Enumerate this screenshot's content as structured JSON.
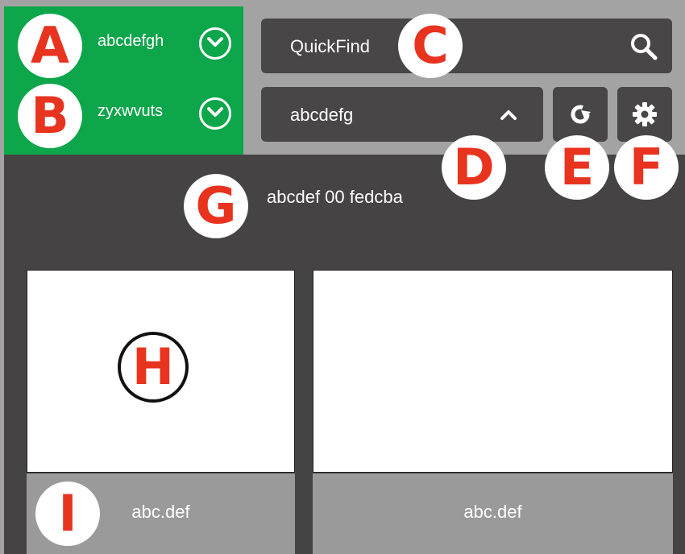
{
  "filters": {
    "filter_a": {
      "label": "abcdefgh",
      "icon": "chevron-down-circle-icon"
    },
    "filter_b": {
      "label": "zyxwvuts",
      "icon": "chevron-down-circle-icon"
    }
  },
  "search": {
    "text": "QuickFind",
    "icon": "search-icon"
  },
  "dropdown": {
    "value": "abcdefg",
    "icon": "chevron-up-icon"
  },
  "toolbar": {
    "refresh_icon": "refresh-icon",
    "settings_icon": "gear-icon"
  },
  "content": {
    "caption": "abcdef 00 fedcba",
    "cards": [
      {
        "label": "abc.def"
      },
      {
        "label": "abc.def"
      }
    ]
  },
  "markers": [
    "A",
    "B",
    "C",
    "D",
    "E",
    "F",
    "G",
    "H",
    "I"
  ],
  "colors": {
    "accent_green": "#0da64a",
    "control_dark": "#484646",
    "background_dark": "#454343",
    "frame_gray": "#a3a3a3",
    "marker_red": "#e8331f"
  }
}
